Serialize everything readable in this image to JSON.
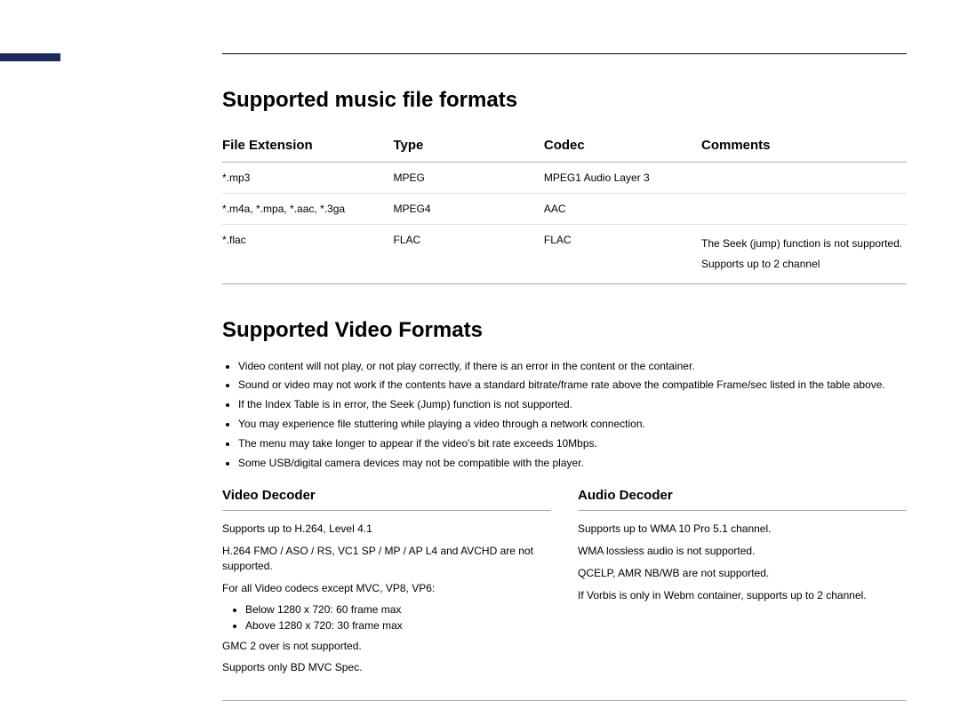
{
  "section1": {
    "title": "Supported music file formats",
    "headers": [
      "File Extension",
      "Type",
      "Codec",
      "Comments"
    ],
    "rows": [
      {
        "ext": "*.mp3",
        "type": "MPEG",
        "codec": "MPEG1 Audio Layer 3",
        "comments": []
      },
      {
        "ext": "*.m4a, *.mpa, *.aac, *.3ga",
        "type": "MPEG4",
        "codec": "AAC",
        "comments": []
      },
      {
        "ext": "*.flac",
        "type": "FLAC",
        "codec": "FLAC",
        "comments": [
          "The Seek (jump) function is not supported.",
          "Supports up to 2 channel"
        ]
      }
    ]
  },
  "section2": {
    "title": "Supported Video Formats",
    "notes": [
      "Video content will not play, or not play correctly, if there is an error in the content or the container.",
      "Sound or video may not work if the contents have a standard bitrate/frame rate above the compatible Frame/sec listed in the table above.",
      "If the Index Table is in error, the Seek (Jump) function is not supported.",
      "You may experience file stuttering while playing a video through a network connection.",
      "The menu may take longer to appear if the video's bit rate exceeds 10Mbps.",
      "Some USB/digital camera devices may not be compatible with the player."
    ],
    "decoders": {
      "video": {
        "title": "Video Decoder",
        "lines_before": [
          "Supports up to H.264, Level 4.1",
          "H.264 FMO / ASO / RS, VC1 SP / MP / AP L4 and AVCHD are not supported.",
          "For all Video codecs except MVC, VP8, VP6:"
        ],
        "bullets": [
          "Below 1280 x 720: 60 frame max",
          "Above 1280 x 720: 30 frame max"
        ],
        "lines_after": [
          "GMC 2 over is not supported.",
          "Supports only BD MVC Spec."
        ]
      },
      "audio": {
        "title": "Audio Decoder",
        "lines": [
          "Supports up to WMA 10 Pro 5.1 channel.",
          "WMA lossless audio is not supported.",
          "QCELP, AMR NB/WB are not supported.",
          "If Vorbis is only in Webm container, supports up to 2 channel."
        ]
      }
    }
  }
}
